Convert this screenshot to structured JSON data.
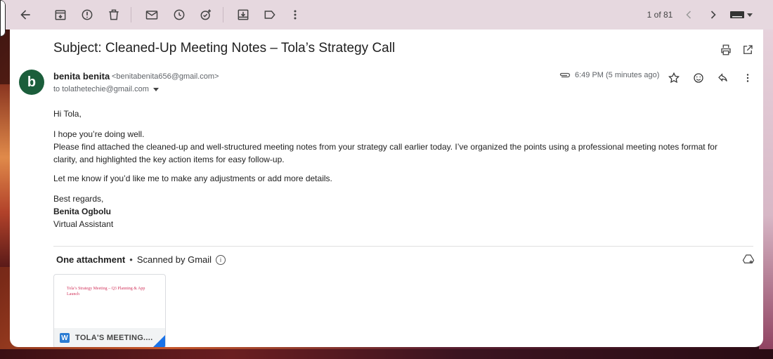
{
  "toolbar": {
    "pager_text": "1 of 81"
  },
  "email": {
    "subject": "Subject: Cleaned-Up Meeting Notes – Tola’s Strategy Call",
    "sender_initial": "b",
    "sender_name": "benita benita",
    "sender_email": "<benitabenita656@gmail.com>",
    "to_line": "to tolathetechie@gmail.com",
    "time": "6:49 PM (5 minutes ago)",
    "greeting": "Hi Tola,",
    "para1_line1": "I hope you’re doing well.",
    "para1_line2": "Please find attached the cleaned-up and well-structured meeting notes from your strategy call earlier today. I’ve organized the points using a professional meeting notes format for clarity, and highlighted the key action items for easy follow-up.",
    "para2": "Let me know if you’d like me to make any adjustments or add more details.",
    "closing": "Best regards,",
    "sig_name": "Benita Ogbolu",
    "sig_title": "Virtual Assistant"
  },
  "attachments": {
    "header_label": "One attachment",
    "scan_label": "Scanned by Gmail",
    "file": {
      "preview_title": "Tola’s Strategy Meeting – Q3 Planning & App Launch",
      "file_label": "TOLA'S MEETING...."
    }
  },
  "colors": {
    "avatar": "#1b5e3b",
    "toolbar_bg": "#e6d8df",
    "word_blue": "#2b7cd3"
  }
}
